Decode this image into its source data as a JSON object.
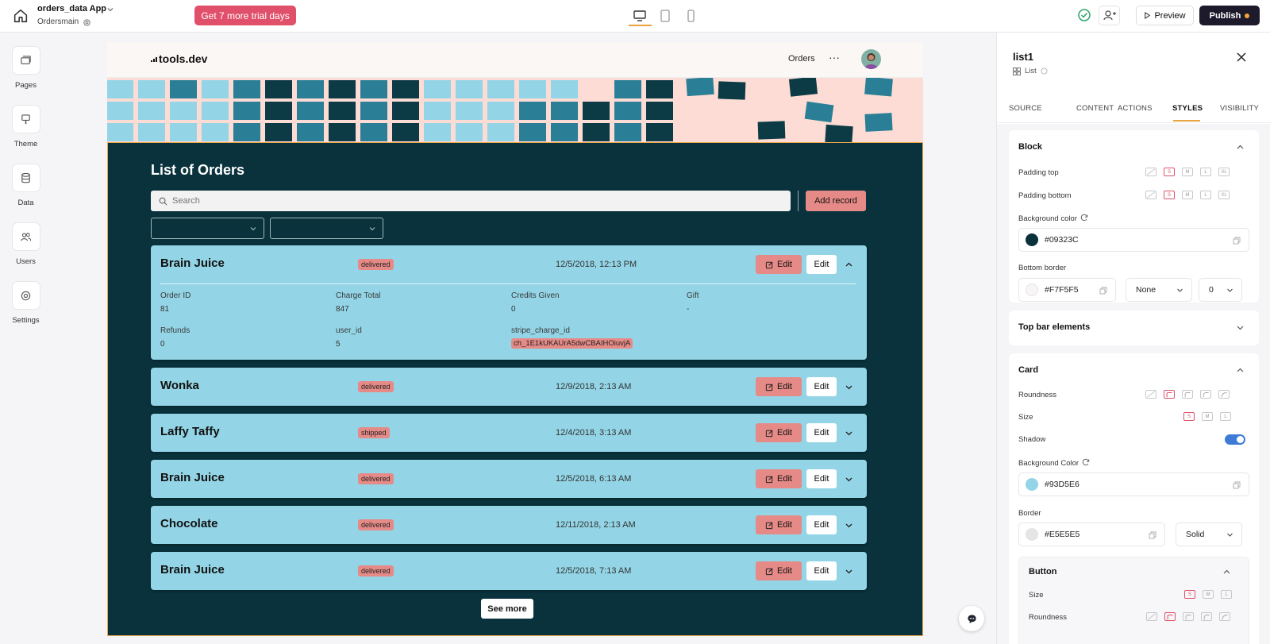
{
  "topbar": {
    "app_name": "orders_data App",
    "page_name": "Ordersmain",
    "trial_button": "Get 7 more trial days",
    "preview_label": "Preview",
    "publish_label": "Publish"
  },
  "leftnav": {
    "items": [
      {
        "label": "Pages",
        "icon": "pages-icon"
      },
      {
        "label": "Theme",
        "icon": "theme-icon"
      },
      {
        "label": "Data",
        "icon": "database-icon"
      },
      {
        "label": "Users",
        "icon": "users-icon"
      },
      {
        "label": "Settings",
        "icon": "settings-icon"
      }
    ]
  },
  "site": {
    "logo": "tools.dev",
    "nav_orders": "Orders",
    "nav_more": "···"
  },
  "list": {
    "title": "List of Orders",
    "search_placeholder": "Search",
    "add_button": "Add record",
    "edit_label": "Edit",
    "see_more": "See more",
    "expanded": {
      "fields": [
        {
          "label": "Order ID",
          "value": "81"
        },
        {
          "label": "Charge Total",
          "value": "847"
        },
        {
          "label": "Credits Given",
          "value": "0"
        },
        {
          "label": "Gift",
          "value": "-"
        },
        {
          "label": "Refunds",
          "value": "0"
        },
        {
          "label": "user_id",
          "value": "5"
        },
        {
          "label": "stripe_charge_id",
          "value": "ch_1E1kUKAUrA5dwCBAIHOiuvjA"
        }
      ]
    },
    "cards": [
      {
        "name": "Brain Juice",
        "status": "delivered",
        "date": "12/5/2018, 12:13 PM"
      },
      {
        "name": "Wonka",
        "status": "delivered",
        "date": "12/9/2018, 2:13 AM"
      },
      {
        "name": "Laffy Taffy",
        "status": "shipped",
        "date": "12/4/2018, 3:13 AM"
      },
      {
        "name": "Brain Juice",
        "status": "delivered",
        "date": "12/5/2018, 6:13 AM"
      },
      {
        "name": "Chocolate",
        "status": "delivered",
        "date": "12/11/2018, 2:13 AM"
      },
      {
        "name": "Brain Juice",
        "status": "delivered",
        "date": "12/5/2018, 7:13 AM"
      }
    ]
  },
  "panel": {
    "title": "list1",
    "subtitle": "List",
    "tabs": [
      "SOURCE",
      "CONTENT",
      "ACTIONS",
      "STYLES",
      "VISIBILITY"
    ],
    "active_tab": "STYLES",
    "block": {
      "title": "Block",
      "padding_top": "Padding top",
      "padding_bottom": "Padding bottom",
      "background_color_label": "Background color",
      "background_color": "#09323C",
      "bottom_border_label": "Bottom border",
      "bottom_border_color": "#F7F5F5",
      "bottom_border_style": "None",
      "bottom_border_width": "0"
    },
    "top_bar_elements": "Top bar elements",
    "card": {
      "title": "Card",
      "roundness": "Roundness",
      "size": "Size",
      "shadow": "Shadow",
      "background_color_label": "Background Color",
      "background_color": "#93D5E6",
      "border_label": "Border",
      "border_color": "#E5E5E5",
      "border_style": "Solid"
    },
    "button": {
      "title": "Button",
      "size": "Size",
      "roundness": "Roundness"
    },
    "size_options": [
      "S",
      "M",
      "L",
      "XL"
    ]
  },
  "colors": {
    "accent": "#e0506a",
    "list_bg": "#09323c",
    "card_bg": "#93d5e6",
    "badge": "#e68a87",
    "pattern_bg": "#fcdcd5"
  }
}
